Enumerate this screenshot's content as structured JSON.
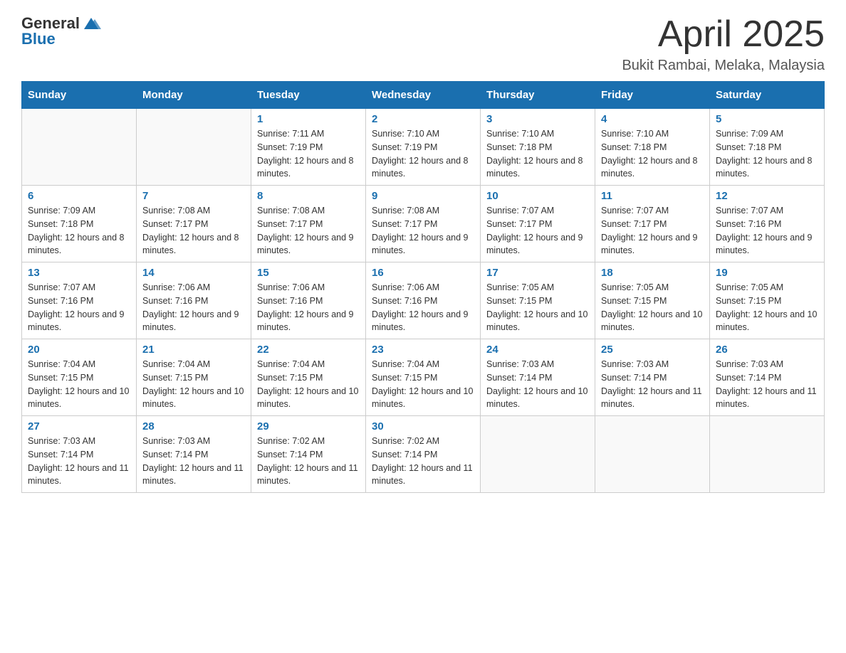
{
  "header": {
    "logo_text_general": "General",
    "logo_text_blue": "Blue",
    "month_title": "April 2025",
    "location": "Bukit Rambai, Melaka, Malaysia"
  },
  "days_of_week": [
    "Sunday",
    "Monday",
    "Tuesday",
    "Wednesday",
    "Thursday",
    "Friday",
    "Saturday"
  ],
  "weeks": [
    [
      {
        "day": "",
        "sunrise": "",
        "sunset": "",
        "daylight": ""
      },
      {
        "day": "",
        "sunrise": "",
        "sunset": "",
        "daylight": ""
      },
      {
        "day": "1",
        "sunrise": "Sunrise: 7:11 AM",
        "sunset": "Sunset: 7:19 PM",
        "daylight": "Daylight: 12 hours and 8 minutes."
      },
      {
        "day": "2",
        "sunrise": "Sunrise: 7:10 AM",
        "sunset": "Sunset: 7:19 PM",
        "daylight": "Daylight: 12 hours and 8 minutes."
      },
      {
        "day": "3",
        "sunrise": "Sunrise: 7:10 AM",
        "sunset": "Sunset: 7:18 PM",
        "daylight": "Daylight: 12 hours and 8 minutes."
      },
      {
        "day": "4",
        "sunrise": "Sunrise: 7:10 AM",
        "sunset": "Sunset: 7:18 PM",
        "daylight": "Daylight: 12 hours and 8 minutes."
      },
      {
        "day": "5",
        "sunrise": "Sunrise: 7:09 AM",
        "sunset": "Sunset: 7:18 PM",
        "daylight": "Daylight: 12 hours and 8 minutes."
      }
    ],
    [
      {
        "day": "6",
        "sunrise": "Sunrise: 7:09 AM",
        "sunset": "Sunset: 7:18 PM",
        "daylight": "Daylight: 12 hours and 8 minutes."
      },
      {
        "day": "7",
        "sunrise": "Sunrise: 7:08 AM",
        "sunset": "Sunset: 7:17 PM",
        "daylight": "Daylight: 12 hours and 8 minutes."
      },
      {
        "day": "8",
        "sunrise": "Sunrise: 7:08 AM",
        "sunset": "Sunset: 7:17 PM",
        "daylight": "Daylight: 12 hours and 9 minutes."
      },
      {
        "day": "9",
        "sunrise": "Sunrise: 7:08 AM",
        "sunset": "Sunset: 7:17 PM",
        "daylight": "Daylight: 12 hours and 9 minutes."
      },
      {
        "day": "10",
        "sunrise": "Sunrise: 7:07 AM",
        "sunset": "Sunset: 7:17 PM",
        "daylight": "Daylight: 12 hours and 9 minutes."
      },
      {
        "day": "11",
        "sunrise": "Sunrise: 7:07 AM",
        "sunset": "Sunset: 7:17 PM",
        "daylight": "Daylight: 12 hours and 9 minutes."
      },
      {
        "day": "12",
        "sunrise": "Sunrise: 7:07 AM",
        "sunset": "Sunset: 7:16 PM",
        "daylight": "Daylight: 12 hours and 9 minutes."
      }
    ],
    [
      {
        "day": "13",
        "sunrise": "Sunrise: 7:07 AM",
        "sunset": "Sunset: 7:16 PM",
        "daylight": "Daylight: 12 hours and 9 minutes."
      },
      {
        "day": "14",
        "sunrise": "Sunrise: 7:06 AM",
        "sunset": "Sunset: 7:16 PM",
        "daylight": "Daylight: 12 hours and 9 minutes."
      },
      {
        "day": "15",
        "sunrise": "Sunrise: 7:06 AM",
        "sunset": "Sunset: 7:16 PM",
        "daylight": "Daylight: 12 hours and 9 minutes."
      },
      {
        "day": "16",
        "sunrise": "Sunrise: 7:06 AM",
        "sunset": "Sunset: 7:16 PM",
        "daylight": "Daylight: 12 hours and 9 minutes."
      },
      {
        "day": "17",
        "sunrise": "Sunrise: 7:05 AM",
        "sunset": "Sunset: 7:15 PM",
        "daylight": "Daylight: 12 hours and 10 minutes."
      },
      {
        "day": "18",
        "sunrise": "Sunrise: 7:05 AM",
        "sunset": "Sunset: 7:15 PM",
        "daylight": "Daylight: 12 hours and 10 minutes."
      },
      {
        "day": "19",
        "sunrise": "Sunrise: 7:05 AM",
        "sunset": "Sunset: 7:15 PM",
        "daylight": "Daylight: 12 hours and 10 minutes."
      }
    ],
    [
      {
        "day": "20",
        "sunrise": "Sunrise: 7:04 AM",
        "sunset": "Sunset: 7:15 PM",
        "daylight": "Daylight: 12 hours and 10 minutes."
      },
      {
        "day": "21",
        "sunrise": "Sunrise: 7:04 AM",
        "sunset": "Sunset: 7:15 PM",
        "daylight": "Daylight: 12 hours and 10 minutes."
      },
      {
        "day": "22",
        "sunrise": "Sunrise: 7:04 AM",
        "sunset": "Sunset: 7:15 PM",
        "daylight": "Daylight: 12 hours and 10 minutes."
      },
      {
        "day": "23",
        "sunrise": "Sunrise: 7:04 AM",
        "sunset": "Sunset: 7:15 PM",
        "daylight": "Daylight: 12 hours and 10 minutes."
      },
      {
        "day": "24",
        "sunrise": "Sunrise: 7:03 AM",
        "sunset": "Sunset: 7:14 PM",
        "daylight": "Daylight: 12 hours and 10 minutes."
      },
      {
        "day": "25",
        "sunrise": "Sunrise: 7:03 AM",
        "sunset": "Sunset: 7:14 PM",
        "daylight": "Daylight: 12 hours and 11 minutes."
      },
      {
        "day": "26",
        "sunrise": "Sunrise: 7:03 AM",
        "sunset": "Sunset: 7:14 PM",
        "daylight": "Daylight: 12 hours and 11 minutes."
      }
    ],
    [
      {
        "day": "27",
        "sunrise": "Sunrise: 7:03 AM",
        "sunset": "Sunset: 7:14 PM",
        "daylight": "Daylight: 12 hours and 11 minutes."
      },
      {
        "day": "28",
        "sunrise": "Sunrise: 7:03 AM",
        "sunset": "Sunset: 7:14 PM",
        "daylight": "Daylight: 12 hours and 11 minutes."
      },
      {
        "day": "29",
        "sunrise": "Sunrise: 7:02 AM",
        "sunset": "Sunset: 7:14 PM",
        "daylight": "Daylight: 12 hours and 11 minutes."
      },
      {
        "day": "30",
        "sunrise": "Sunrise: 7:02 AM",
        "sunset": "Sunset: 7:14 PM",
        "daylight": "Daylight: 12 hours and 11 minutes."
      },
      {
        "day": "",
        "sunrise": "",
        "sunset": "",
        "daylight": ""
      },
      {
        "day": "",
        "sunrise": "",
        "sunset": "",
        "daylight": ""
      },
      {
        "day": "",
        "sunrise": "",
        "sunset": "",
        "daylight": ""
      }
    ]
  ]
}
